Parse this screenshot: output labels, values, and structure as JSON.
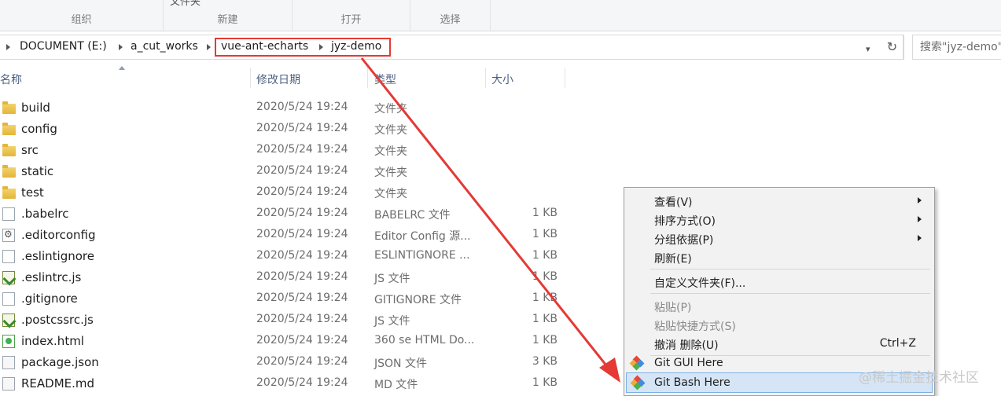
{
  "ribbon": {
    "groups": [
      {
        "label": "组织",
        "peek": ""
      },
      {
        "label": "新建",
        "peek": "文件夹"
      },
      {
        "label": "打开",
        "peek": ""
      },
      {
        "label": "选择",
        "peek": ""
      }
    ]
  },
  "address": {
    "crumbs": [
      "DOCUMENT (E:)",
      "a_cut_works",
      "vue-ant-echarts",
      "jyz-demo"
    ],
    "search_placeholder": "搜索\"jyz-demo\""
  },
  "columns": {
    "name": "名称",
    "modified": "修改日期",
    "type": "类型",
    "size": "大小"
  },
  "files": [
    {
      "name": "build",
      "date": "2020/5/24 19:24",
      "type": "文件夹",
      "size": "",
      "icon": "folder-icon"
    },
    {
      "name": "config",
      "date": "2020/5/24 19:24",
      "type": "文件夹",
      "size": "",
      "icon": "folder-icon"
    },
    {
      "name": "src",
      "date": "2020/5/24 19:24",
      "type": "文件夹",
      "size": "",
      "icon": "folder-icon"
    },
    {
      "name": "static",
      "date": "2020/5/24 19:24",
      "type": "文件夹",
      "size": "",
      "icon": "folder-icon"
    },
    {
      "name": "test",
      "date": "2020/5/24 19:24",
      "type": "文件夹",
      "size": "",
      "icon": "folder-icon"
    },
    {
      "name": ".babelrc",
      "date": "2020/5/24 19:24",
      "type": "BABELRC 文件",
      "size": "1 KB",
      "icon": "file-icon"
    },
    {
      "name": ".editorconfig",
      "date": "2020/5/24 19:24",
      "type": "Editor Config 源...",
      "size": "1 KB",
      "icon": "config-file-icon"
    },
    {
      "name": ".eslintignore",
      "date": "2020/5/24 19:24",
      "type": "ESLINTIGNORE ...",
      "size": "1 KB",
      "icon": "file-icon"
    },
    {
      "name": ".eslintrc.js",
      "date": "2020/5/24 19:24",
      "type": "JS 文件",
      "size": "1 KB",
      "icon": "js-file-icon"
    },
    {
      "name": ".gitignore",
      "date": "2020/5/24 19:24",
      "type": "GITIGNORE 文件",
      "size": "1 KB",
      "icon": "file-icon"
    },
    {
      "name": ".postcssrc.js",
      "date": "2020/5/24 19:24",
      "type": "JS 文件",
      "size": "1 KB",
      "icon": "js-file-icon"
    },
    {
      "name": "index.html",
      "date": "2020/5/24 19:24",
      "type": "360 se HTML Do...",
      "size": "1 KB",
      "icon": "html-file-icon"
    },
    {
      "name": "package.json",
      "date": "2020/5/24 19:24",
      "type": "JSON 文件",
      "size": "3 KB",
      "icon": "json-file-icon"
    },
    {
      "name": "README.md",
      "date": "2020/5/24 19:24",
      "type": "MD 文件",
      "size": "1 KB",
      "icon": "md-file-icon"
    }
  ],
  "context_menu": {
    "items": [
      {
        "label": "查看(V)",
        "submenu": true
      },
      {
        "label": "排序方式(O)",
        "submenu": true
      },
      {
        "label": "分组依据(P)",
        "submenu": true
      },
      {
        "label": "刷新(E)"
      },
      {
        "label": "自定义文件夹(F)..."
      },
      {
        "label": "粘贴(P)",
        "disabled": true
      },
      {
        "label": "粘贴快捷方式(S)",
        "disabled": true
      },
      {
        "label": "撤消 删除(U)",
        "shortcut": "Ctrl+Z"
      },
      {
        "label": "Git GUI Here",
        "icon": "git-icon"
      },
      {
        "label": "Git Bash Here",
        "icon": "git-icon",
        "highlighted": true
      }
    ]
  },
  "watermark": "@稀土掘金技术社区",
  "colors": {
    "highlight": "#e53935",
    "menu_hover": "#d5e5f6",
    "header_text": "#4d6082"
  }
}
